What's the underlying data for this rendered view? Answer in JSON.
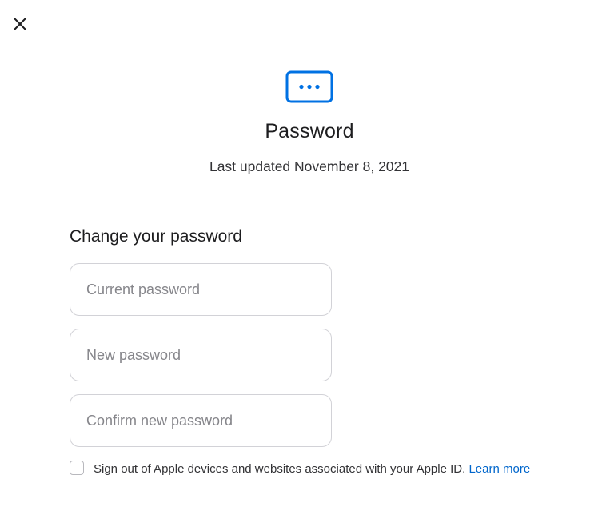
{
  "dialog": {
    "close_icon": "close-icon",
    "icon": "password-dots-icon",
    "accent_color": "#0071e3",
    "title": "Password",
    "last_updated": "Last updated November 8, 2021"
  },
  "form": {
    "section_title": "Change your password",
    "current_password": {
      "placeholder": "Current password",
      "value": ""
    },
    "new_password": {
      "placeholder": "New password",
      "value": ""
    },
    "confirm_password": {
      "placeholder": "Confirm new password",
      "value": ""
    },
    "signout_checkbox": {
      "checked": false,
      "label": "Sign out of Apple devices and websites associated with your Apple ID.",
      "link_label": "Learn more",
      "link_color": "#0066cc"
    }
  }
}
